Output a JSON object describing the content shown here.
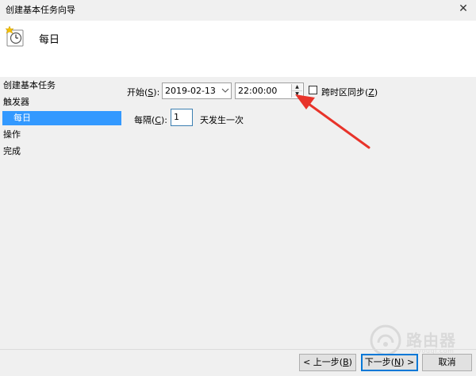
{
  "window": {
    "title": "创建基本任务向导",
    "close": "✕"
  },
  "header": {
    "title": "每日"
  },
  "sidebar": {
    "items": [
      {
        "label": "创建基本任务"
      },
      {
        "label": "触发器"
      },
      {
        "label": "每日"
      },
      {
        "label": "操作"
      },
      {
        "label": "完成"
      }
    ]
  },
  "start": {
    "label": "开始(",
    "key": "S",
    "label_end": "):",
    "date": "2019-02-13",
    "time": "22:00:00"
  },
  "sync": {
    "label": "跨时区同步(",
    "key": "Z",
    "label_end": ")"
  },
  "interval": {
    "label": "每隔(",
    "key": "C",
    "label_end": "):",
    "value": "1",
    "suffix": "天发生一次"
  },
  "buttons": {
    "back": {
      "label": "< 上一步(",
      "key": "B",
      "label_end": ")"
    },
    "next": {
      "label": "下一步(",
      "key": "N",
      "label_end": ") >"
    },
    "cancel": "取消"
  },
  "watermark": {
    "text": "路由器",
    "sub": "luyouqi.com"
  },
  "colors": {
    "selection": "#3399ff",
    "arrow": "#e8332a"
  }
}
